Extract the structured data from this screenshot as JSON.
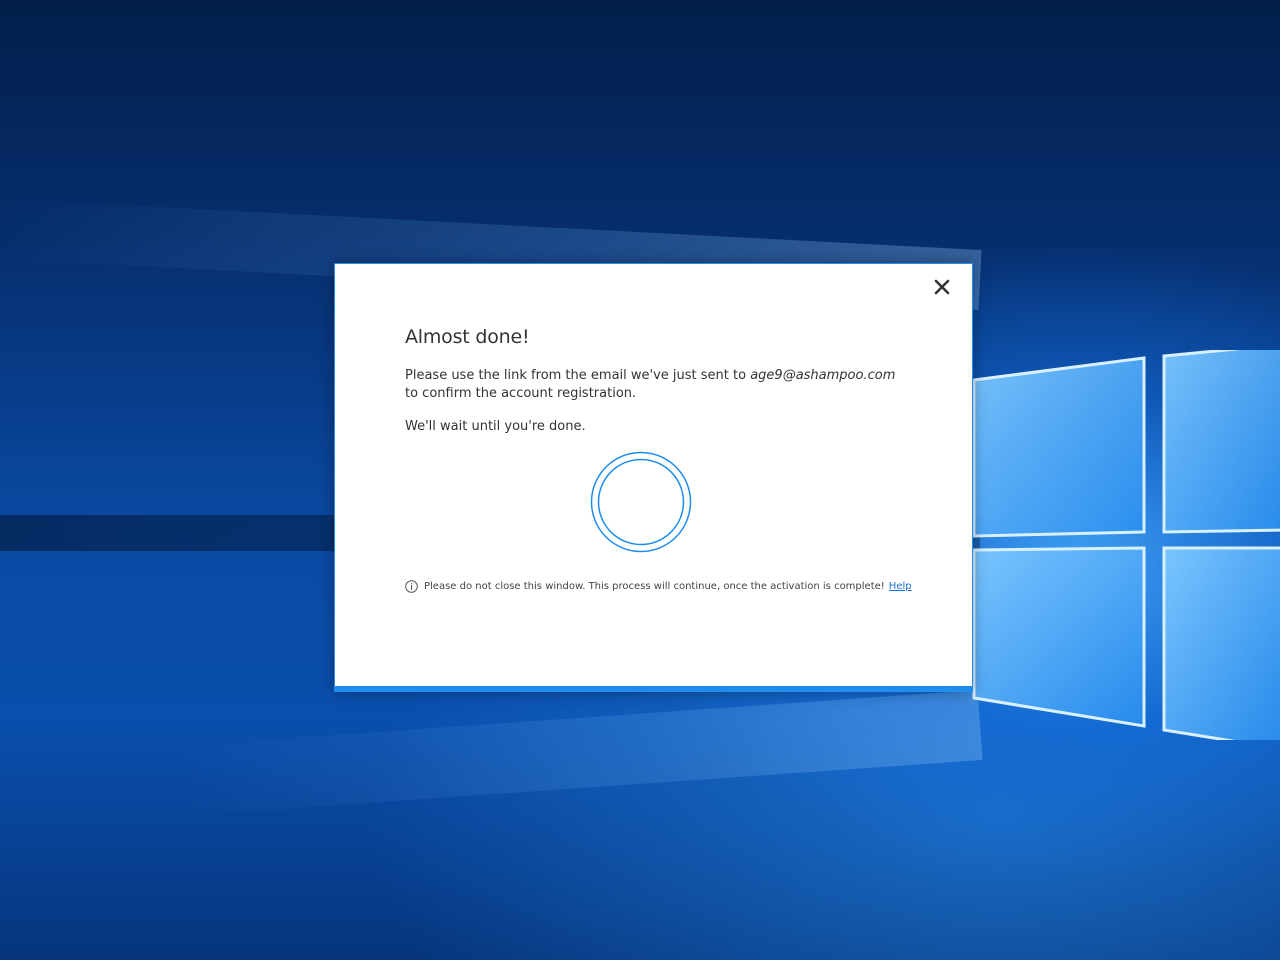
{
  "desktop": {
    "wallpaper": "windows-10-hero",
    "accent_color": "#0a4fae"
  },
  "dialog": {
    "close_icon": "close-icon",
    "title": "Almost done!",
    "message_before_email": "Please use the link from the email we've just sent to ",
    "email": "age9@ashampoo.com",
    "message_after_email": " to confirm the account registration.",
    "wait_text": "We'll wait until you're done.",
    "spinner_icon": "loading-ring-icon",
    "spinner_color": "#1d8df0",
    "notice_icon": "info-icon",
    "notice_text": "Please do not close this window. This process will continue, once the activation is complete!",
    "help_link": "Help",
    "accent_bar_color": "#1d8df0"
  }
}
